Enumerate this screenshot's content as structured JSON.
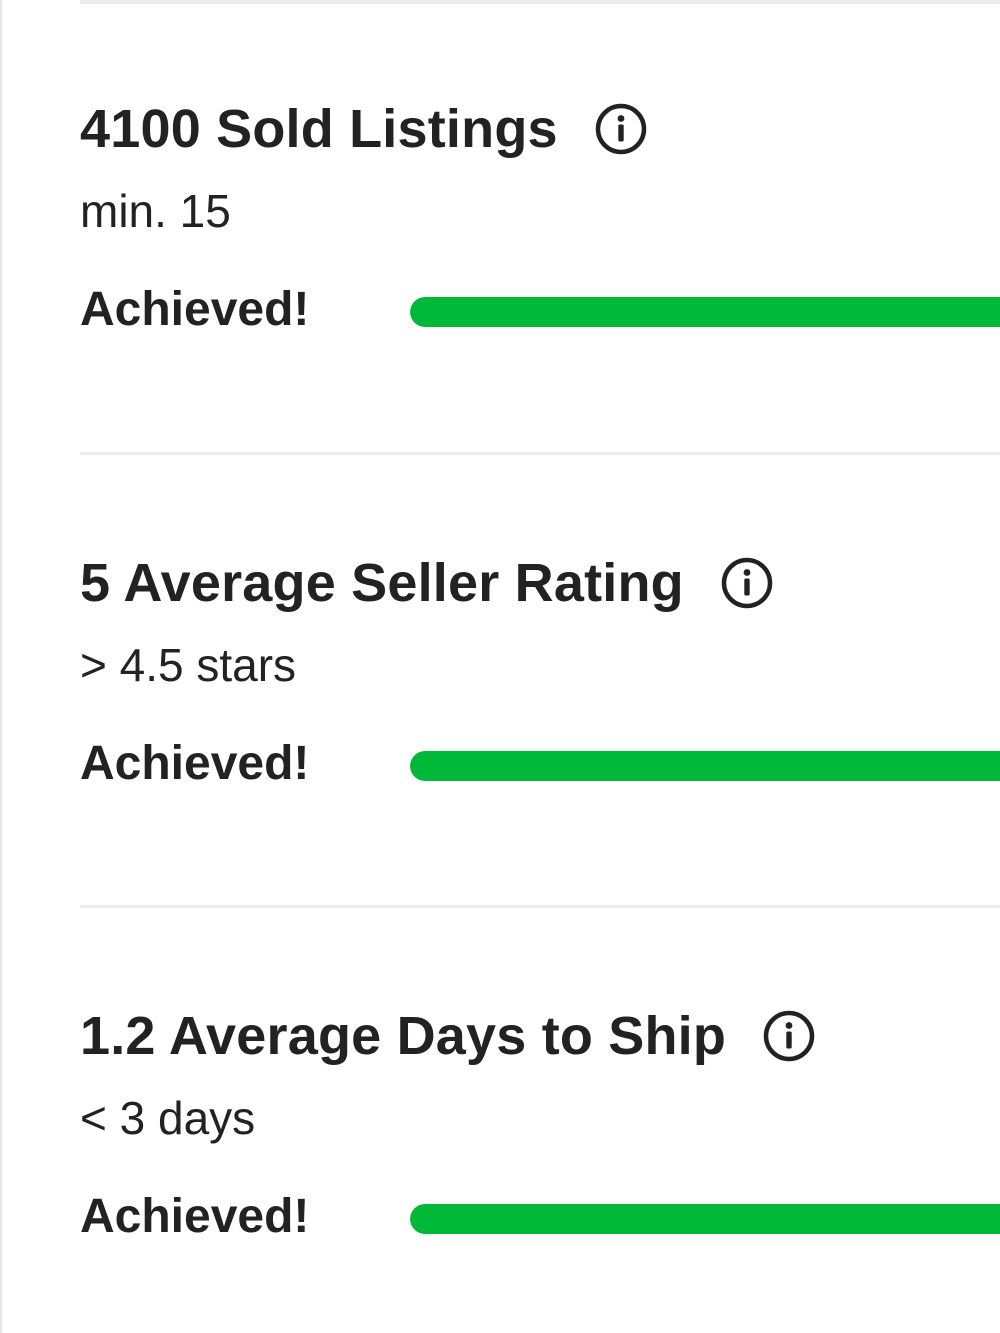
{
  "colors": {
    "progress_fill": "#00b837",
    "text": "#222222",
    "divider": "#ececec"
  },
  "metrics": [
    {
      "title": "4100 Sold Listings",
      "requirement": "min. 15",
      "status": "Achieved!",
      "progress_percent": 100,
      "icon": "info-icon"
    },
    {
      "title": "5 Average Seller Rating",
      "requirement": "> 4.5 stars",
      "status": "Achieved!",
      "progress_percent": 100,
      "icon": "info-icon"
    },
    {
      "title": "1.2 Average Days to Ship",
      "requirement": "< 3 days",
      "status": "Achieved!",
      "progress_percent": 100,
      "icon": "info-icon"
    }
  ]
}
